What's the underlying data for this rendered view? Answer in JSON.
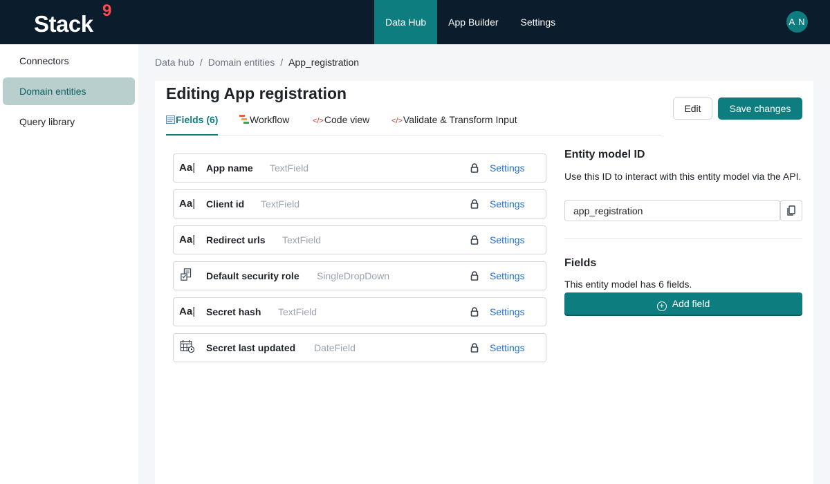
{
  "brand": {
    "name": "Stack",
    "mark": "9"
  },
  "nav": {
    "items": [
      {
        "label": "Data Hub",
        "active": true
      },
      {
        "label": "App Builder",
        "active": false
      },
      {
        "label": "Settings",
        "active": false
      }
    ],
    "avatar_initials": "A N"
  },
  "sidebar": {
    "items": [
      {
        "label": "Connectors",
        "active": false
      },
      {
        "label": "Domain entities",
        "active": true
      },
      {
        "label": "Query library",
        "active": false
      }
    ]
  },
  "breadcrumb": [
    "Data hub",
    "Domain entities",
    "App_registration"
  ],
  "breadcrumb_separator": "/",
  "page": {
    "title": "Editing App registration",
    "edit_label": "Edit",
    "save_label": "Save changes"
  },
  "tabs": [
    {
      "label": "Fields (6)",
      "icon": "fields-icon",
      "active": true
    },
    {
      "label": "Workflow",
      "icon": "workflow-icon",
      "active": false
    },
    {
      "label": "Code view",
      "icon": "code-icon",
      "active": false
    },
    {
      "label": "Validate & Transform Input",
      "icon": "code-icon",
      "active": false
    }
  ],
  "fields": [
    {
      "name": "App name",
      "type": "TextField",
      "icon": "text-field-icon",
      "action": "Settings"
    },
    {
      "name": "Client id",
      "type": "TextField",
      "icon": "text-field-icon",
      "action": "Settings"
    },
    {
      "name": "Redirect urls",
      "type": "TextField",
      "icon": "text-field-icon",
      "action": "Settings"
    },
    {
      "name": "Default security role",
      "type": "SingleDropDown",
      "icon": "dropdown-field-icon",
      "action": "Settings"
    },
    {
      "name": "Secret hash",
      "type": "TextField",
      "icon": "text-field-icon",
      "action": "Settings"
    },
    {
      "name": "Secret last updated",
      "type": "DateField",
      "icon": "date-field-icon",
      "action": "Settings"
    }
  ],
  "entity_model": {
    "title": "Entity model ID",
    "description": "Use this ID to interact with this entity model via the API.",
    "id_value": "app_registration"
  },
  "fields_panel": {
    "title": "Fields",
    "count_text": "This entity model has 6 fields.",
    "add_label": "Add field"
  },
  "colors": {
    "topbar": "#0b1c2c",
    "accent": "#0e7d80",
    "brand_mark": "#ff4b4b",
    "link": "#1e6fd9",
    "sidebar_active": "#b9cfcd"
  }
}
